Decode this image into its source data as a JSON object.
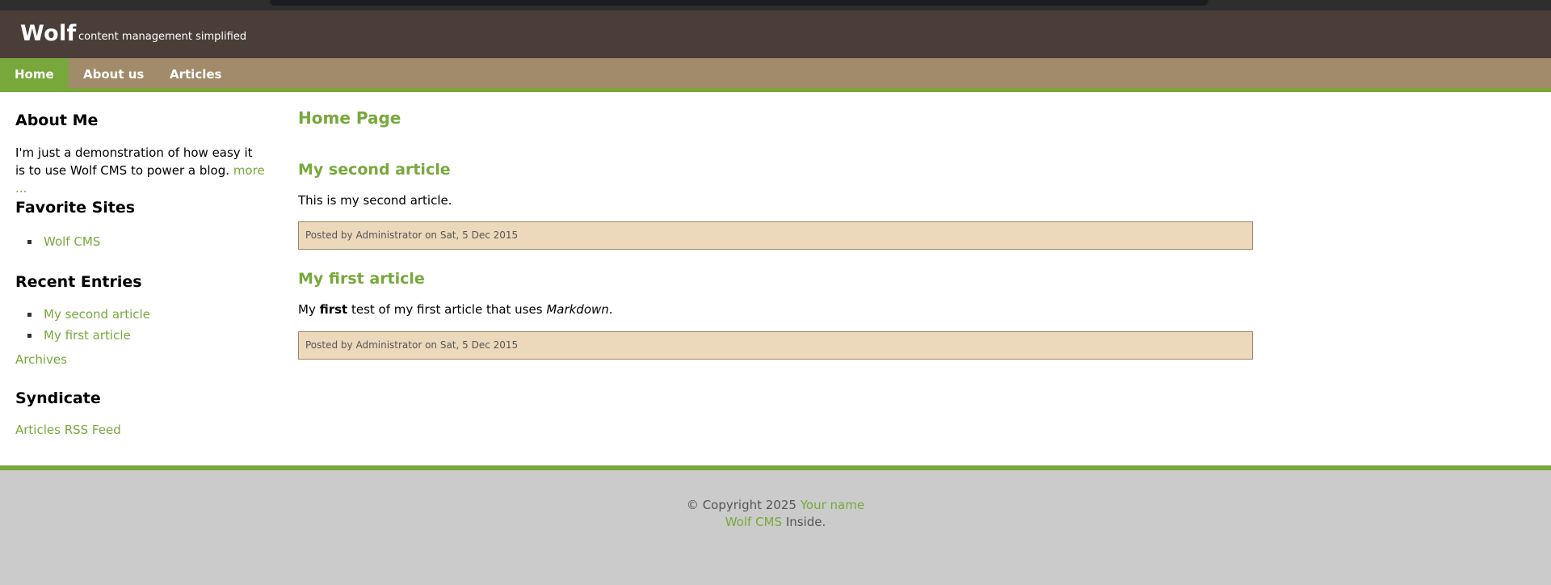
{
  "site": {
    "name": "Wolf",
    "tagline": "content management simplified"
  },
  "nav": {
    "items": [
      {
        "label": "Home",
        "active": true
      },
      {
        "label": "About us",
        "active": false
      },
      {
        "label": "Articles",
        "active": false
      }
    ]
  },
  "sidebar": {
    "about": {
      "title": "About Me",
      "text": "I'm just a demonstration of how easy it is to use Wolf CMS to power a blog.",
      "more_link": "more ..."
    },
    "favorites": {
      "title": "Favorite Sites",
      "items": [
        "Wolf CMS"
      ]
    },
    "recent": {
      "title": "Recent Entries",
      "items": [
        "My second article",
        "My first article"
      ],
      "archives_link": "Archives"
    },
    "syndicate": {
      "title": "Syndicate",
      "feed_link": "Articles RSS Feed"
    }
  },
  "main": {
    "page_title": "Home Page",
    "articles": [
      {
        "title": "My second article",
        "body": "This is my second article.",
        "meta": "Posted by Administrator on Sat, 5 Dec 2015"
      },
      {
        "title": "My first article",
        "body_before": "My ",
        "body_bold": "first",
        "body_middle": " test of my first article that uses ",
        "body_italic": "Markdown",
        "body_after": ".",
        "meta": "Posted by Administrator on Sat, 5 Dec 2015"
      }
    ]
  },
  "footer": {
    "copyright": "© Copyright 2025",
    "your_name_link": "Your name",
    "cms_link": "Wolf CMS",
    "inside_text": "Inside."
  },
  "colors": {
    "accent_green": "#78a83b",
    "header_bg": "#4b3e38",
    "nav_bg": "#a28b6b",
    "meta_bg": "#ecd9bb",
    "footer_bg": "#cbcbcb"
  }
}
